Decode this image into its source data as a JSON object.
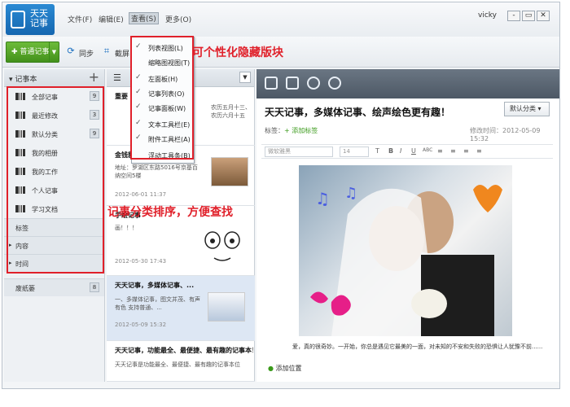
{
  "app": {
    "logo_text": "天天记事",
    "user": "vicky"
  },
  "menubar": {
    "file": "文件(F)",
    "edit": "编辑(E)",
    "view": "查看(S)",
    "more": "更多(O)"
  },
  "window": {
    "minimize": "-",
    "restore": "▭",
    "close": "✕"
  },
  "toolbar": {
    "new_note": "普通记事",
    "sync": "同步",
    "screenshot": "截屏"
  },
  "view_menu": {
    "items": [
      {
        "label": "列表视图(L)",
        "checked": true
      },
      {
        "label": "缩略图视图(T)",
        "checked": false
      },
      {
        "label": "左面板(H)",
        "checked": true
      },
      {
        "label": "记事列表(O)",
        "checked": true
      },
      {
        "label": "记事面板(W)",
        "checked": true
      },
      {
        "label": "文本工具栏(E)",
        "checked": true
      },
      {
        "label": "附件工具栏(A)",
        "checked": true
      },
      {
        "label": "浮动工具条(B)",
        "checked": false
      }
    ]
  },
  "annotations": {
    "top": "可个性化隐藏版块",
    "side": "记事分类排序，方便查找"
  },
  "sidebar": {
    "header": "记事本",
    "items": [
      {
        "label": "全部记事",
        "count": "9"
      },
      {
        "label": "最近修改",
        "count": "3"
      },
      {
        "label": "默认分类",
        "count": "9"
      },
      {
        "label": "我的相册",
        "count": ""
      },
      {
        "label": "我的工作",
        "count": ""
      },
      {
        "label": "个人记事",
        "count": ""
      },
      {
        "label": "学习文档",
        "count": ""
      }
    ],
    "groups": {
      "tags": "标签",
      "content": "内容",
      "time": "时间"
    },
    "trash": {
      "label": "废纸篓",
      "count": "8"
    }
  },
  "notes": [
    {
      "title": "重要",
      "body": "农历五月十三、农历六月十五",
      "date": ""
    },
    {
      "title": "金钱豹聚餐活动日...",
      "body": "地址：罗湖区东路5016号京基百纳空间5楼",
      "date": "2012-06-01 11:37"
    },
    {
      "title": "手绘记事",
      "body": "画！！！",
      "date": "2012-05-30 17:43"
    },
    {
      "title": "天天记事，多媒体记事、...",
      "body": "一、多媒体记事，图文并茂、有声有色 支持普通、...",
      "date": "2012-05-09 15:32"
    },
    {
      "title": "天天记事，功能最全、最便捷、最有趣的记事本！",
      "body": "天天记事是功能最全、最便捷、最有趣的记事本位",
      "date": ""
    }
  ],
  "editor": {
    "title": "天天记事，多媒体记事、绘声绘色更有趣！",
    "category": "默认分类",
    "tags_label": "标签：",
    "add_tag": "添加标签",
    "modified": "修改时间：2012-05-09 15:32",
    "font": "微软雅黑",
    "size": "14",
    "caption": "爱，真的很奇妙。一开始，你总是遇见它最美的一面，对未知的不安和失败的恐惧让人犹豫不前......",
    "add_location": "添加位置"
  },
  "colors": {
    "accent_green": "#4ea322",
    "annotation_red": "#e0202a",
    "editor_toolbar": "#5a6572"
  },
  "icons": [
    "pen-logo-icon",
    "sync-icon",
    "crop-icon",
    "plus-icon",
    "image-icon",
    "camera-icon",
    "smiley-icon",
    "alarm-icon",
    "location-pin-icon"
  ]
}
